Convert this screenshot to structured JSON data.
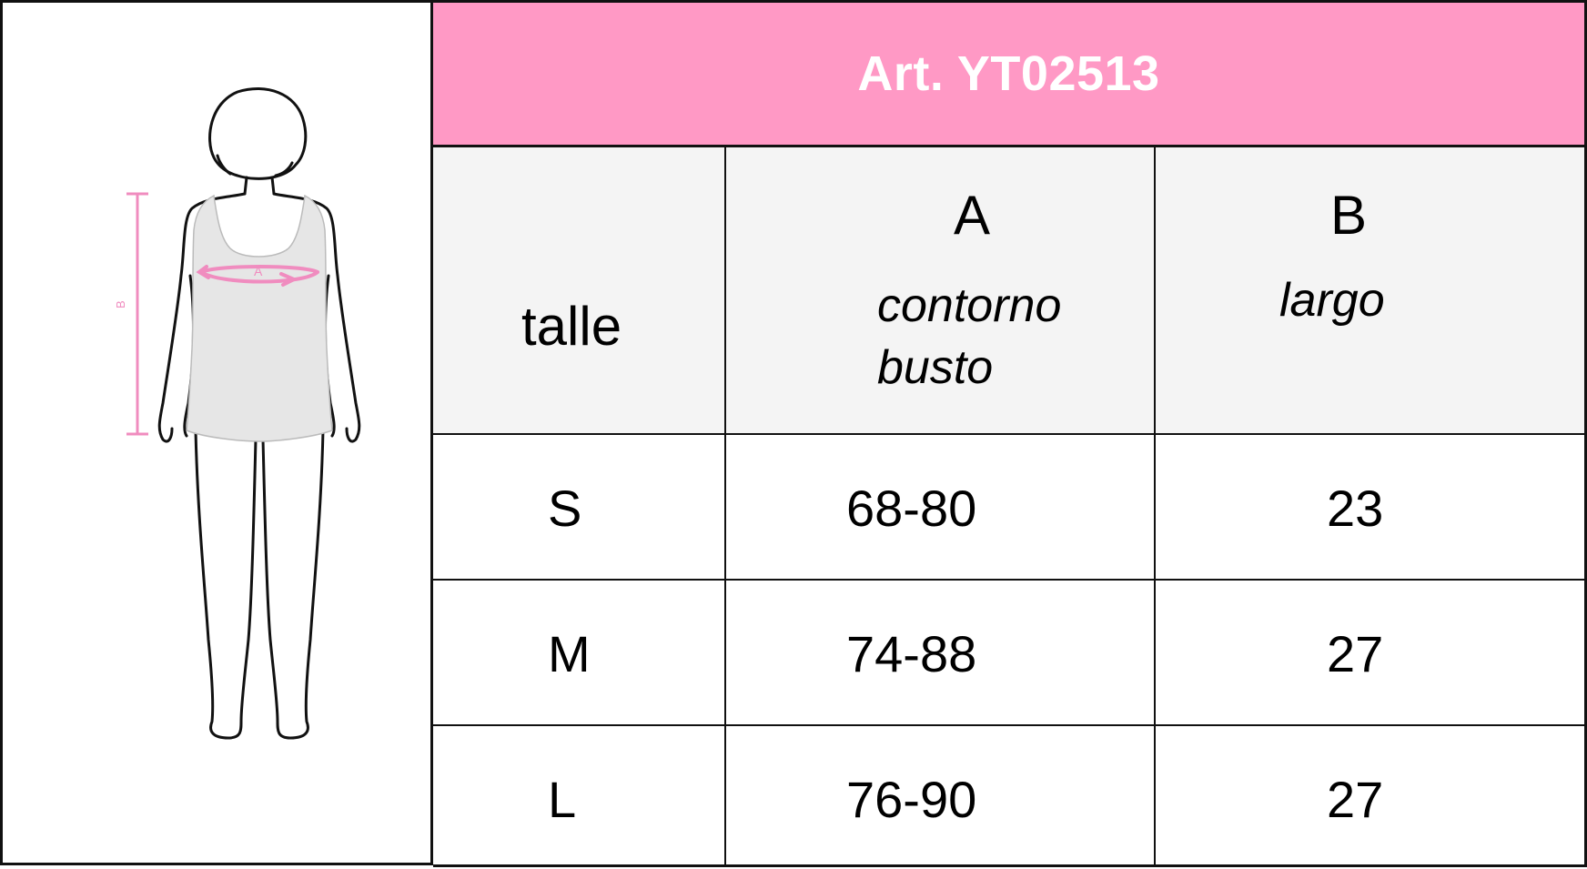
{
  "title": "Art. YT02513",
  "figure": {
    "label_a": "A",
    "label_b": "B",
    "accent_color": "#f08cbf"
  },
  "table": {
    "header": {
      "size_label": "talle",
      "col_a": "A",
      "col_a_desc_line1": "contorno",
      "col_a_desc_line2": "busto",
      "col_b": "B",
      "col_b_desc": "largo"
    },
    "rows": [
      {
        "size": "S",
        "a": "68-80",
        "b": "23"
      },
      {
        "size": "M",
        "a": "74-88",
        "b": "27"
      },
      {
        "size": "L",
        "a": "76-90",
        "b": "27"
      }
    ]
  },
  "colors": {
    "title_bg": "#ff99c5",
    "header_bg": "#f4f4f4",
    "border": "#111111"
  }
}
